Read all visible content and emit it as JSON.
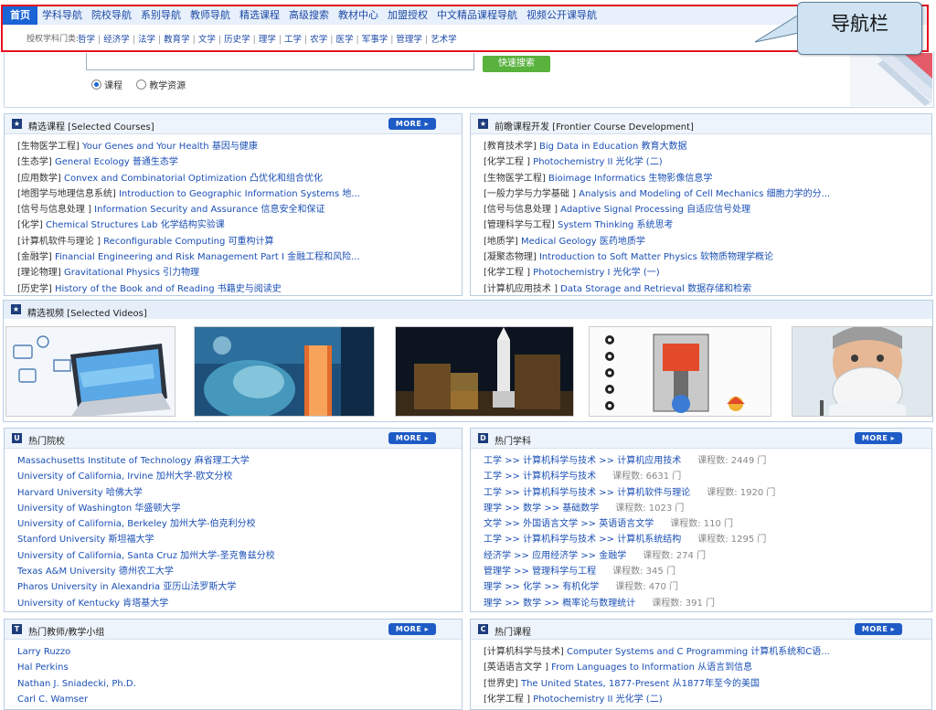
{
  "top_nav": {
    "items": [
      "首页",
      "学科导航",
      "院校导航",
      "系别导航",
      "教师导航",
      "精选课程",
      "高级搜索",
      "教材中心",
      "加盟授权",
      "中文精品课程导航",
      "视频公开课导航"
    ]
  },
  "sub_nav": {
    "prefix": "授权学科门类:",
    "links": [
      "哲学",
      "经济学",
      "法学",
      "教育学",
      "文学",
      "历史学",
      "理学",
      "工学",
      "农学",
      "医学",
      "军事学",
      "管理学",
      "艺术学"
    ]
  },
  "callout": {
    "text": "导航栏"
  },
  "search": {
    "input_value": "",
    "button_label": "快速搜索",
    "options": [
      {
        "label": "课程",
        "selected": true
      },
      {
        "label": "教学资源",
        "selected": false
      }
    ]
  },
  "more_label": "MORE ▸",
  "panels": {
    "selected_courses": {
      "title": "精选课程 [Selected Courses]",
      "items": [
        {
          "cat": "[生物医学工程] ",
          "title": "Your Genes and Your Health 基因与健康"
        },
        {
          "cat": "[生态学] ",
          "title": "General Ecology 普通生态学"
        },
        {
          "cat": "[应用数学] ",
          "title": "Convex and Combinatorial Optimization 凸优化和组合优化"
        },
        {
          "cat": "[地图学与地理信息系统] ",
          "title": "Introduction to Geographic Information Systems 地..."
        },
        {
          "cat": "[信号与信息处理 ] ",
          "title": "Information Security and Assurance 信息安全和保证"
        },
        {
          "cat": "[化学] ",
          "title": "Chemical Structures Lab 化学结构实验课"
        },
        {
          "cat": "[计算机软件与理论 ] ",
          "title": "Reconfigurable Computing 可重构计算"
        },
        {
          "cat": "[金融学] ",
          "title": "Financial Engineering and Risk Management Part I 金融工程和风险..."
        },
        {
          "cat": "[理论物理] ",
          "title": "Gravitational Physics 引力物理"
        },
        {
          "cat": "[历史学] ",
          "title": "History of the Book and of Reading 书籍史与阅读史"
        }
      ]
    },
    "frontier": {
      "title": "前瞻课程开发 [Frontier Course Development]",
      "items": [
        {
          "cat": "[教育技术学] ",
          "title": "Big Data in Education 教育大数据"
        },
        {
          "cat": "[化学工程 ] ",
          "title": "Photochemistry II 光化学 (二)"
        },
        {
          "cat": "[生物医学工程] ",
          "title": "Bioimage Informatics 生物影像信息学"
        },
        {
          "cat": "[一般力学与力学基础 ] ",
          "title": "Analysis and Modeling of Cell Mechanics 细胞力学的分..."
        },
        {
          "cat": "[信号与信息处理 ] ",
          "title": "Adaptive Signal Processing 自适应信号处理"
        },
        {
          "cat": "[管理科学与工程] ",
          "title": "System Thinking 系统思考"
        },
        {
          "cat": "[地质学] ",
          "title": "Medical Geology 医药地质学"
        },
        {
          "cat": "[凝聚态物理] ",
          "title": "Introduction to Soft Matter Physics 软物质物理学概论"
        },
        {
          "cat": "[化学工程 ] ",
          "title": "Photochemistry I 光化学 (一)"
        },
        {
          "cat": "[计算机应用技术 ] ",
          "title": "Data Storage and Retrieval 数据存储和检索"
        }
      ]
    },
    "videos": {
      "title": "精选视频 [Selected Videos]"
    },
    "hot_universities": {
      "title": "热门院校",
      "items": [
        "Massachusetts Institute of Technology 麻省理工大学",
        "University of California, Irvine 加州大学-欧文分校",
        "Harvard University 哈佛大学",
        "University of Washington 华盛顿大学",
        "University of California, Berkeley 加州大学-伯克利分校",
        "Stanford University 斯坦福大学",
        "University of California, Santa Cruz 加州大学-圣克鲁兹分校",
        "Texas A&M University 德州农工大学",
        "Pharos University in Alexandria 亚历山法罗斯大学",
        "University of Kentucky 肯塔基大学"
      ]
    },
    "hot_subjects": {
      "title": "热门学科",
      "items": [
        {
          "path": "工学 >> 计算机科学与技术 >> 计算机应用技术",
          "count": "课程数: 2449 门"
        },
        {
          "path": "工学 >> 计算机科学与技术",
          "count": "课程数: 6631 门"
        },
        {
          "path": "工学 >> 计算机科学与技术 >> 计算机软件与理论",
          "count": "课程数: 1920 门"
        },
        {
          "path": "理学 >> 数学 >> 基础数学",
          "count": "课程数: 1023 门"
        },
        {
          "path": "文学 >> 外国语言文学 >> 英语语言文学",
          "count": "课程数: 110 门"
        },
        {
          "path": "工学 >> 计算机科学与技术 >> 计算机系统结构",
          "count": "课程数: 1295 门"
        },
        {
          "path": "经济学 >> 应用经济学 >> 金融学",
          "count": "课程数: 274 门"
        },
        {
          "path": "管理学 >> 管理科学与工程",
          "count": "课程数: 345 门"
        },
        {
          "path": "理学 >> 化学 >> 有机化学",
          "count": "课程数: 470 门"
        },
        {
          "path": "理学 >> 数学 >> 概率论与数理统计",
          "count": "课程数: 391 门"
        }
      ]
    },
    "hot_teachers": {
      "title": "热门教师/教学小组",
      "items": [
        "Larry Ruzzo",
        "Hal Perkins",
        "Nathan J. Sniadecki, Ph.D.",
        "Carl C. Wamser"
      ]
    },
    "hot_courses": {
      "title": "热门课程",
      "items": [
        {
          "cat": "[计算机科学与技术] ",
          "title": "Computer Systems and C Programming 计算机系统和C语..."
        },
        {
          "cat": "[英语语言文学 ] ",
          "title": "From Languages to Information 从语言到信息"
        },
        {
          "cat": "[世界史] ",
          "title": "The United States, 1877-Present 从1877年至今的美国"
        },
        {
          "cat": "[化学工程 ] ",
          "title": "Photochemistry II 光化学 (二)"
        }
      ]
    }
  },
  "colors": {
    "nav_active": "#1a64d6",
    "frame_red": "#e4121f",
    "link": "#1a4fb5",
    "more_btn": "#1e5bc6",
    "search_btn": "#58b23c"
  }
}
